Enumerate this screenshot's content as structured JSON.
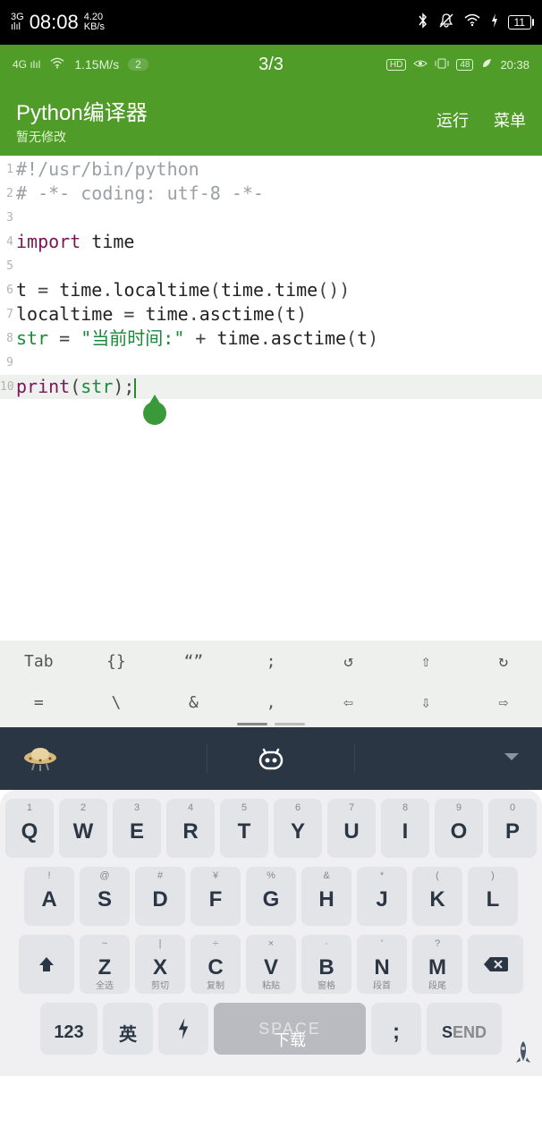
{
  "sys_statusbar": {
    "signal_label": "3G",
    "signal_bars": "ılıl",
    "time": "08:08",
    "speed_num": "4.20",
    "speed_unit": "KB/s",
    "bt": "✱",
    "bell": "🔕",
    "wifi": "wifi",
    "bolt": "⚡",
    "battery": "11"
  },
  "sec_statusbar": {
    "sig": "4G ılıl",
    "wifi": "wifi",
    "speed": "1.15M/s",
    "badge": "2",
    "center": "3/3",
    "hd": "HD",
    "eye": "👁",
    "vib": "📳",
    "bat": "48",
    "leaf": "🍃",
    "time": "20:38"
  },
  "app_header": {
    "title": "Python编译器",
    "subtitle": "暂无修改",
    "run": "运行",
    "menu": "菜单"
  },
  "code": {
    "lines": [
      {
        "n": "1",
        "tokens": [
          [
            "comment",
            "#!/usr/bin/python"
          ]
        ]
      },
      {
        "n": "2",
        "tokens": [
          [
            "comment",
            "# -*- coding: utf-8 -*-"
          ]
        ]
      },
      {
        "n": "3",
        "tokens": []
      },
      {
        "n": "4",
        "tokens": [
          [
            "keyword",
            "import"
          ],
          [
            "ident",
            " time"
          ]
        ]
      },
      {
        "n": "5",
        "tokens": []
      },
      {
        "n": "6",
        "tokens": [
          [
            "ident",
            "t "
          ],
          [
            "punct",
            "= "
          ],
          [
            "ident",
            "time"
          ],
          [
            "punct",
            "."
          ],
          [
            "func",
            "localtime"
          ],
          [
            "punct",
            "("
          ],
          [
            "ident",
            "time"
          ],
          [
            "punct",
            "."
          ],
          [
            "func",
            "time"
          ],
          [
            "punct",
            "())"
          ]
        ]
      },
      {
        "n": "7",
        "tokens": [
          [
            "ident",
            "localtime "
          ],
          [
            "punct",
            "= "
          ],
          [
            "ident",
            "time"
          ],
          [
            "punct",
            "."
          ],
          [
            "func",
            "asctime"
          ],
          [
            "punct",
            "("
          ],
          [
            "ident",
            "t"
          ],
          [
            "punct",
            ")"
          ]
        ]
      },
      {
        "n": "8",
        "tokens": [
          [
            "builtin",
            "str"
          ],
          [
            "ident",
            " "
          ],
          [
            "punct",
            "= "
          ],
          [
            "string",
            "\"当前时间:\""
          ],
          [
            "punct",
            " + "
          ],
          [
            "ident",
            "time"
          ],
          [
            "punct",
            "."
          ],
          [
            "func",
            "asctime"
          ],
          [
            "punct",
            "("
          ],
          [
            "ident",
            "t"
          ],
          [
            "punct",
            ")"
          ]
        ]
      },
      {
        "n": "9",
        "tokens": []
      },
      {
        "n": "10",
        "tokens": [
          [
            "keyword",
            "print"
          ],
          [
            "punct",
            "("
          ],
          [
            "builtin",
            "str"
          ],
          [
            "punct",
            ");"
          ]
        ],
        "current": true
      }
    ]
  },
  "shortcuts": {
    "row1": [
      "Tab",
      "{}",
      "“”",
      ";",
      "↺",
      "⇧",
      "↻"
    ],
    "row2": [
      "=",
      "\\",
      "&",
      ",",
      "⇦",
      "⇩",
      "⇨"
    ]
  },
  "keyboard": {
    "row1": [
      {
        "sup": "1",
        "main": "Q"
      },
      {
        "sup": "2",
        "main": "W"
      },
      {
        "sup": "3",
        "main": "E"
      },
      {
        "sup": "4",
        "main": "R"
      },
      {
        "sup": "5",
        "main": "T"
      },
      {
        "sup": "6",
        "main": "Y"
      },
      {
        "sup": "7",
        "main": "U"
      },
      {
        "sup": "8",
        "main": "I"
      },
      {
        "sup": "9",
        "main": "O"
      },
      {
        "sup": "0",
        "main": "P"
      }
    ],
    "row2": [
      {
        "sup": "!",
        "main": "A"
      },
      {
        "sup": "@",
        "main": "S"
      },
      {
        "sup": "#",
        "main": "D"
      },
      {
        "sup": "¥",
        "main": "F"
      },
      {
        "sup": "%",
        "main": "G"
      },
      {
        "sup": "&",
        "main": "H"
      },
      {
        "sup": "*",
        "main": "J"
      },
      {
        "sup": "(",
        "main": "K"
      },
      {
        "sup": ")",
        "main": "L"
      }
    ],
    "row3": [
      {
        "sup": "~",
        "main": "Z",
        "sub": "全选"
      },
      {
        "sup": "|",
        "main": "X",
        "sub": "剪切"
      },
      {
        "sup": "÷",
        "main": "C",
        "sub": "复制"
      },
      {
        "sup": "×",
        "main": "V",
        "sub": "粘贴"
      },
      {
        "sup": "·",
        "main": "B",
        "sub": "窗格"
      },
      {
        "sup": "'",
        "main": "N",
        "sub": "段首"
      },
      {
        "sup": "?",
        "main": "M",
        "sub": "段尾"
      }
    ],
    "row4": {
      "num": "123",
      "lang": "英",
      "space": "SPACE",
      "download": "下载",
      "semi": ";",
      "send": "SEND"
    }
  }
}
